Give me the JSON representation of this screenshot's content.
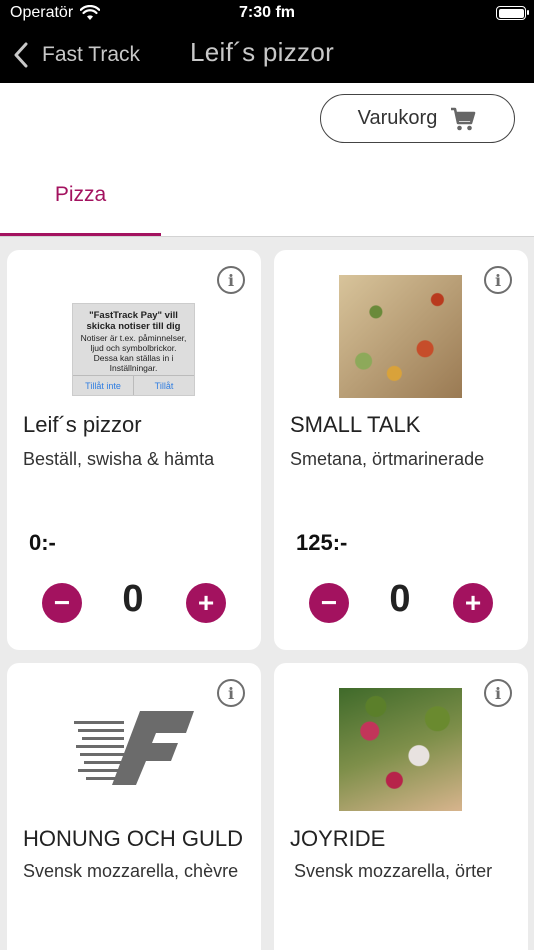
{
  "status_bar": {
    "carrier": "Operatör",
    "time": "7:30 fm"
  },
  "nav": {
    "back_label": "Fast Track",
    "title": "Leif´s pizzor"
  },
  "cart_button": {
    "label": "Varukorg"
  },
  "tabs": [
    {
      "label": "Pizza",
      "selected": true
    }
  ],
  "colors": {
    "accent": "#a3125f"
  },
  "products": [
    {
      "title": "Leif´s pizzor",
      "description": "Beställ, swisha & hämta",
      "price": "0:-",
      "quantity": "0",
      "image": {
        "title": "\"FastTrack Pay\" vill skicka notiser till dig",
        "body": "Notiser är t.ex. påminnelser, ljud och symbolbrickor. Dessa kan ställas in i Inställningar.",
        "deny": "Tillåt inte",
        "allow": "Tillåt"
      }
    },
    {
      "title": "SMALL TALK",
      "description": "Smetana, örtmarinerade",
      "price": "125:-",
      "quantity": "0"
    },
    {
      "title": "HONUNG OCH GULD",
      "description": "Svensk mozzarella, chèvre"
    },
    {
      "title": "JOYRIDE",
      "description": "Svensk mozzarella, örter"
    }
  ],
  "info_glyph": "i",
  "minus_glyph": "−",
  "plus_glyph": "+"
}
